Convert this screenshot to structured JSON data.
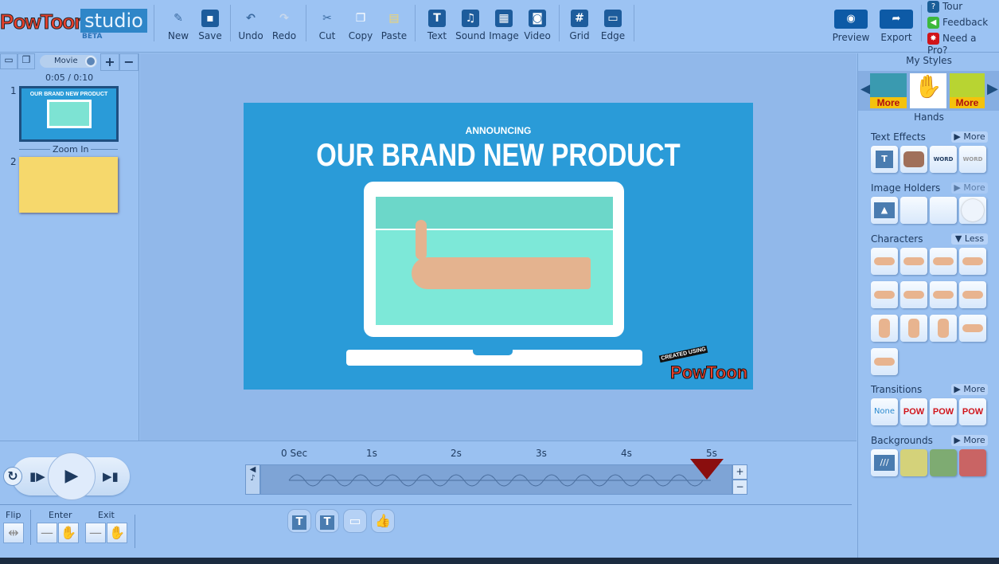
{
  "app": {
    "logo": "PowToon",
    "studio": "studio",
    "beta": "BETA"
  },
  "toolbar": {
    "items": [
      {
        "label": "New",
        "icon": "new-icon"
      },
      {
        "label": "Save",
        "icon": "save-icon"
      },
      {
        "label": "Undo",
        "icon": "undo-icon"
      },
      {
        "label": "Redo",
        "icon": "redo-icon"
      },
      {
        "label": "Cut",
        "icon": "scissors-icon"
      },
      {
        "label": "Copy",
        "icon": "copy-icon"
      },
      {
        "label": "Paste",
        "icon": "paste-icon"
      },
      {
        "label": "Text",
        "icon": "text-icon"
      },
      {
        "label": "Sound",
        "icon": "sound-icon"
      },
      {
        "label": "Image",
        "icon": "image-icon"
      },
      {
        "label": "Video",
        "icon": "video-icon"
      },
      {
        "label": "Grid",
        "icon": "grid-icon"
      },
      {
        "label": "Edge",
        "icon": "edge-icon"
      }
    ],
    "preview": "Preview",
    "export": "Export",
    "tour": "Tour",
    "feedback": "Feedback",
    "pro": "Need a Pro?"
  },
  "left": {
    "mode": "Movie",
    "time": "0:05 / 0:10",
    "slides": [
      {
        "num": "1"
      },
      {
        "num": "2"
      }
    ],
    "transition": "Zoom In",
    "thumb_title": "OUR BRAND NEW PRODUCT"
  },
  "slide": {
    "kicker": "ANNOUNCING",
    "title": "OUR BRAND NEW PRODUCT",
    "badge_top": "CREATED USING",
    "badge": "PowToon",
    "bg": "#2a9bd8"
  },
  "right": {
    "my_styles": "My Styles",
    "style_more": "More",
    "style_selected": "Hands",
    "text_effects": "Text Effects",
    "image_holders": "Image Holders",
    "characters": "Characters",
    "transitions": "Transitions",
    "backgrounds": "Backgrounds",
    "more": "More",
    "less": "Less",
    "none": "None",
    "pow": "POW",
    "word": "WORD",
    "bg_colors": [
      "#d4d27a",
      "#7eab72",
      "#c96464"
    ]
  },
  "timeline": {
    "ticks": [
      "0 Sec",
      "1s",
      "2s",
      "3s",
      "4s",
      "5s"
    ],
    "playhead_seconds": 5
  },
  "bottom": {
    "flip": "Flip",
    "enter": "Enter",
    "exit": "Exit"
  }
}
